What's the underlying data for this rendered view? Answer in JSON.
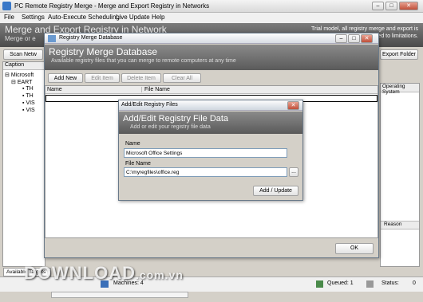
{
  "window": {
    "title": "PC Remote Registry Merge - Merge and Export Registry in Networks"
  },
  "menu": [
    "File",
    "Settings",
    "Auto-Execute Scheduling",
    "Live Update",
    "Help"
  ],
  "header": {
    "title": "Merge and Export Registry in Network",
    "subtitle": "Merge or e",
    "trial": "Trial model, all registry merge and export is registered to limitations."
  },
  "toolbar": {
    "scan": "Scan Netw",
    "export_folder": "Export Folder"
  },
  "left": {
    "caption": "Caption",
    "tree": [
      "Microsoft",
      "EART",
      "TH",
      "TH",
      "VIS",
      "VIS"
    ]
  },
  "right": {
    "col_os": "Operating System",
    "col_reason": "Reason"
  },
  "merge_dialog": {
    "title": "Registry Merge Database",
    "header_title": "Registry Merge Database",
    "header_sub": "Available registry files that you can merge to remote computers at any time",
    "buttons": {
      "add_new": "Add New",
      "edit": "Edit Item",
      "delete": "Delete Item",
      "clear": "Clear All"
    },
    "columns": {
      "name": "Name",
      "file": "File Name"
    },
    "ok": "OK"
  },
  "edit_dialog": {
    "title": "Add/Edit Registry Files",
    "header_title": "Add/Edit Registry File Data",
    "header_sub": "Add or edit your registry file data",
    "name_label": "Name",
    "name_value": "Microsoft Office Settings",
    "file_label": "File Name",
    "file_value": "C:\\myregfiles\\office.reg",
    "browse": "...",
    "submit": "Add / Update"
  },
  "status": {
    "tab": "Available Targets",
    "machines": "Machines:  4",
    "queued": "Queued:  1",
    "status": "Status:",
    "status_value": "0"
  },
  "watermark": {
    "main": "DOWNLOAD",
    "sub": ".com.vn"
  }
}
